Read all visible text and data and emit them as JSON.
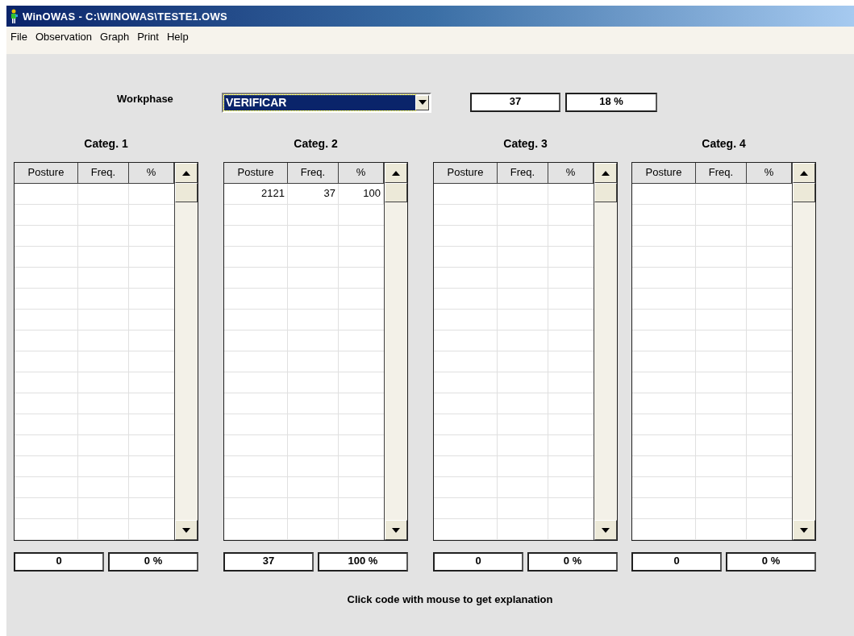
{
  "window": {
    "title": "WinOWAS - C:\\WINOWAS\\TESTE1.OWS"
  },
  "menu": [
    "File",
    "Observation",
    "Graph",
    "Print",
    "Help"
  ],
  "workphase": {
    "label": "Workphase",
    "value": "VERIFICAR",
    "count": "37",
    "percent": "18 %"
  },
  "categories": [
    {
      "title": "Categ. 1",
      "columns": [
        "Posture",
        "Freq.",
        "%"
      ],
      "total_count": "0",
      "total_percent": "0 %"
    },
    {
      "title": "Categ. 2",
      "columns": [
        "Posture",
        "Freq.",
        "%"
      ],
      "rows": [
        [
          "2121",
          "37",
          "100"
        ]
      ],
      "total_count": "37",
      "total_percent": "100 %"
    },
    {
      "title": "Categ. 3",
      "columns": [
        "Posture",
        "Freq.",
        "%"
      ],
      "total_count": "0",
      "total_percent": "0 %"
    },
    {
      "title": "Categ. 4",
      "columns": [
        "Posture",
        "Freq.",
        "%"
      ],
      "total_count": "0",
      "total_percent": "0 %"
    }
  ],
  "hint": "Click code with mouse to get explanation"
}
